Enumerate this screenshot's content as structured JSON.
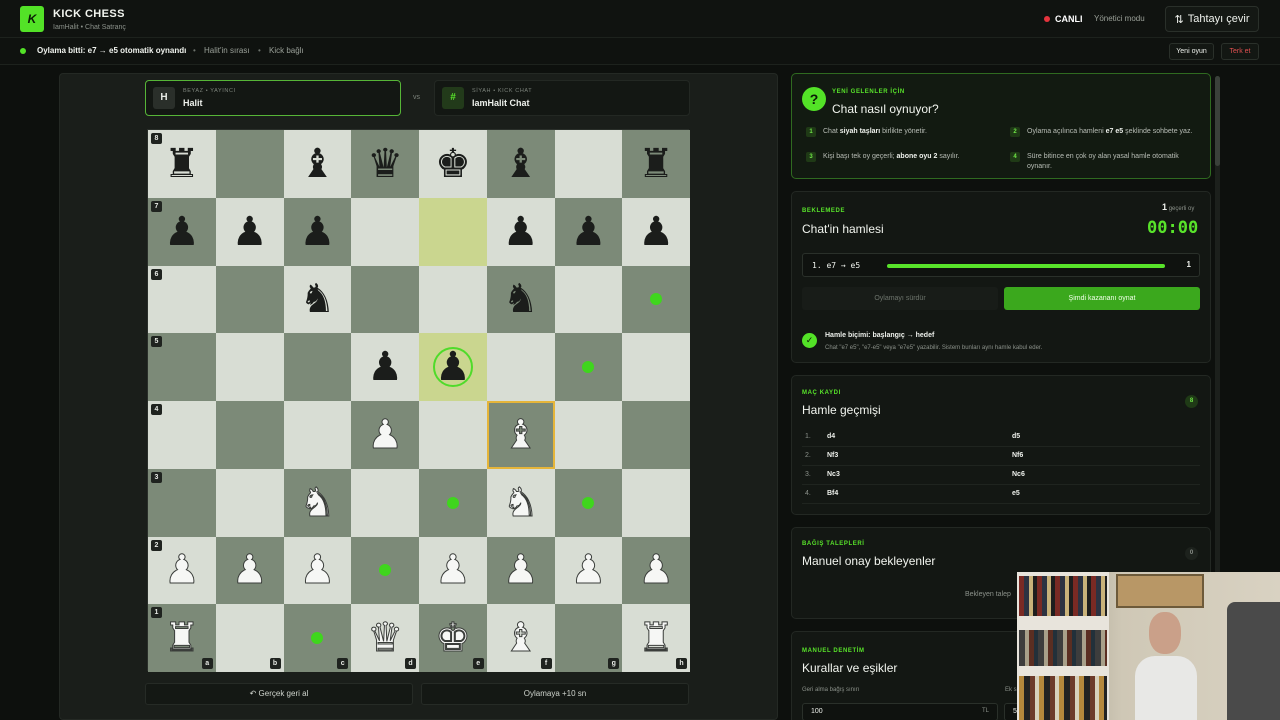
{
  "header": {
    "logo_letter": "K",
    "title": "KICK CHESS",
    "subtitle": "IamHalit • Chat Satranç",
    "live_label": "CANLI",
    "admin_label": "Yönetici modu",
    "flip_label": "Tahtayı çevir",
    "flip_icon": "⇅"
  },
  "status": {
    "message": "Oylama bitti: e7 → e5 otomatik oynandı",
    "turn": "Halit'in sırası",
    "connection": "Kick bağlı",
    "sep": "•",
    "new_game": "Yeni oyun",
    "resign": "Terk et"
  },
  "players": {
    "white": {
      "avatar": "H",
      "role": "BEYAZ • YAYINCI",
      "name": "Halit"
    },
    "vs": "vs",
    "black": {
      "avatar": "#",
      "role": "SİYAH • KICK CHAT",
      "name": "IamHalit Chat"
    }
  },
  "board": {
    "ranks": [
      "8",
      "7",
      "6",
      "5",
      "4",
      "3",
      "2",
      "1"
    ],
    "files": [
      "a",
      "b",
      "c",
      "d",
      "e",
      "f",
      "g",
      "h"
    ],
    "rows": [
      [
        "r",
        "",
        "b",
        "q",
        "k",
        "b",
        "",
        "r"
      ],
      [
        "p",
        "p",
        "p",
        "",
        "",
        "p",
        "p",
        "p"
      ],
      [
        "",
        "",
        "n",
        "",
        "",
        "n",
        "",
        ""
      ],
      [
        "",
        "",
        "",
        "p",
        "p",
        "",
        "",
        ""
      ],
      [
        "",
        "",
        "",
        "P",
        "",
        "B",
        "",
        ""
      ],
      [
        "",
        "",
        "N",
        "",
        "",
        "N",
        "",
        ""
      ],
      [
        "P",
        "P",
        "P",
        "",
        "P",
        "P",
        "P",
        "P"
      ],
      [
        "R",
        "",
        "",
        "Q",
        "K",
        "B",
        "",
        "R"
      ]
    ],
    "highlight": [
      "e7",
      "e5"
    ],
    "selected": "f4",
    "ring": "e5",
    "dots": [
      "h6",
      "g5",
      "e3",
      "g3",
      "d2",
      "c1"
    ]
  },
  "board_actions": {
    "undo": "↶ Gerçek geri al",
    "extend": "Oylamaya +10 sn"
  },
  "help": {
    "icon": "?",
    "tag": "YENİ GELENLER İÇİN",
    "title": "Chat nasıl oynuyor?",
    "steps": [
      {
        "n": "1",
        "pre": "Chat ",
        "bold": "siyah taşları",
        "post": " birlikte yönetir."
      },
      {
        "n": "2",
        "pre": "Oylama açılınca hamleni ",
        "bold": "e7 e5",
        "post": " şeklinde sohbete yaz."
      },
      {
        "n": "3",
        "pre": "Kişi başı tek oy geçerli; ",
        "bold": "abone oyu 2",
        "post": " sayılır."
      },
      {
        "n": "4",
        "pre": "Süre bitince en çok oy alan yasal hamle otomatik oynanır.",
        "bold": "",
        "post": ""
      }
    ]
  },
  "vote": {
    "tag": "BEKLEMEDE",
    "title": "Chat'in hamlesi",
    "count": "1",
    "count_label": "geçerli oy",
    "timer": "00:00",
    "move": "1. e7 → e5",
    "move_votes": "1",
    "move_share": 1.0,
    "stop_label": "Oylamayı sürdür",
    "play_label": "Şimdi kazananı oynat",
    "format_icon": "✓",
    "format_title": "Hamle biçimi: başlangıç → hedef",
    "format_desc": "Chat \"e7 e5\", \"e7-e5\" veya \"e7e5\" yazabilir. Sistem bunları aynı hamle kabul eder."
  },
  "history": {
    "tag": "MAÇ KAYDI",
    "title": "Hamle geçmişi",
    "count": "8",
    "moves": [
      {
        "num": "1.",
        "white": "d4",
        "black": "d5"
      },
      {
        "num": "2.",
        "white": "Nf3",
        "black": "Nf6"
      },
      {
        "num": "3.",
        "white": "Nc3",
        "black": "Nc6"
      },
      {
        "num": "4.",
        "white": "Bf4",
        "black": "e5"
      }
    ]
  },
  "donations": {
    "tag": "BAĞIŞ TALEPLERİ",
    "title": "Manuel onay bekleyenler",
    "count": "0",
    "empty": "Bekleyen talep"
  },
  "manual": {
    "tag": "MANUEL DENETİM",
    "title": "Kurallar ve eşikler",
    "field1_label": "Geri alma bağış sınırı",
    "field1_value": "100",
    "field1_unit": "TL",
    "field2_label": "Ek s",
    "field2_value": "50"
  },
  "colors": {
    "accent": "#53e227",
    "live": "#e5343d",
    "danger": "#e05050",
    "selected_outline": "#e5b53a"
  }
}
